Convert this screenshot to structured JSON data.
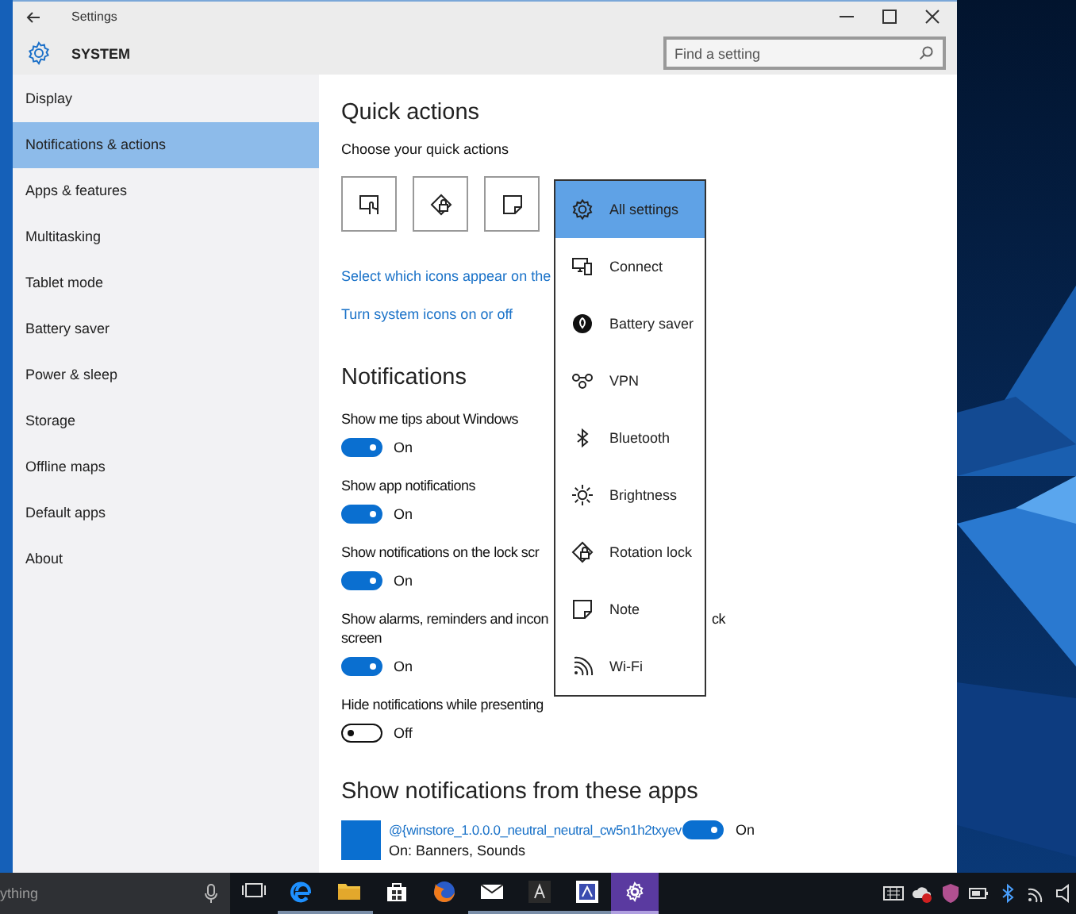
{
  "window": {
    "title": "Settings"
  },
  "header": {
    "title": "SYSTEM",
    "search": {
      "placeholder": "Find a setting"
    }
  },
  "sidebar": {
    "items": [
      {
        "label": "Display",
        "selected": false
      },
      {
        "label": "Notifications & actions",
        "selected": true
      },
      {
        "label": "Apps & features",
        "selected": false
      },
      {
        "label": "Multitasking",
        "selected": false
      },
      {
        "label": "Tablet mode",
        "selected": false
      },
      {
        "label": "Battery saver",
        "selected": false
      },
      {
        "label": "Power & sleep",
        "selected": false
      },
      {
        "label": "Storage",
        "selected": false
      },
      {
        "label": "Offline maps",
        "selected": false
      },
      {
        "label": "Default apps",
        "selected": false
      },
      {
        "label": "About",
        "selected": false
      }
    ]
  },
  "quick_actions": {
    "title": "Quick actions",
    "subtitle": "Choose your quick actions",
    "tiles": [
      {
        "kind": "tablet"
      },
      {
        "kind": "rotation"
      },
      {
        "kind": "note"
      }
    ],
    "links": [
      "Select which icons appear on the",
      "Turn system icons on or off"
    ]
  },
  "flyout": {
    "items": [
      {
        "kind": "settings",
        "label": "All settings",
        "selected": true
      },
      {
        "kind": "connect",
        "label": "Connect",
        "selected": false
      },
      {
        "kind": "battery",
        "label": "Battery saver",
        "selected": false
      },
      {
        "kind": "vpn",
        "label": "VPN",
        "selected": false
      },
      {
        "kind": "bluetooth",
        "label": "Bluetooth",
        "selected": false
      },
      {
        "kind": "brightness",
        "label": "Brightness",
        "selected": false
      },
      {
        "kind": "rotation",
        "label": "Rotation lock",
        "selected": false
      },
      {
        "kind": "note",
        "label": "Note",
        "selected": false
      },
      {
        "kind": "wifi",
        "label": "Wi-Fi",
        "selected": false
      }
    ]
  },
  "notifications": {
    "title": "Notifications",
    "settings": [
      {
        "label": "Show me tips about Windows",
        "on": true,
        "state_text": "On"
      },
      {
        "label": "Show app notifications",
        "on": true,
        "state_text": "On"
      },
      {
        "label": "Show notifications on the lock scr",
        "on": true,
        "state_text": "On"
      },
      {
        "label": "Show alarms, reminders and incon",
        "label_tail": "ck",
        "label_line2": "screen",
        "on": true,
        "state_text": "On"
      },
      {
        "label": "Hide notifications while presenting",
        "on": false,
        "state_text": "Off"
      }
    ]
  },
  "apps": {
    "title": "Show notifications from these apps",
    "items": [
      {
        "name": "@{winstore_1.0.0.0_neutral_neutral_cw5n1h2txyev",
        "detail": "On: Banners, Sounds",
        "on": true,
        "state_text": "On"
      }
    ]
  },
  "taskbar": {
    "search_text": "ything",
    "buttons": [
      {
        "kind": "taskview",
        "running": false,
        "active": false
      },
      {
        "kind": "edge",
        "running": true,
        "active": false
      },
      {
        "kind": "folder",
        "running": true,
        "active": false
      },
      {
        "kind": "store",
        "running": false,
        "active": false
      },
      {
        "kind": "firefox",
        "running": false,
        "active": false
      },
      {
        "kind": "mail",
        "running": true,
        "active": false
      },
      {
        "kind": "adobe",
        "running": true,
        "active": false
      },
      {
        "kind": "app",
        "running": true,
        "active": false
      },
      {
        "kind": "settings",
        "running": true,
        "active": true
      }
    ]
  }
}
